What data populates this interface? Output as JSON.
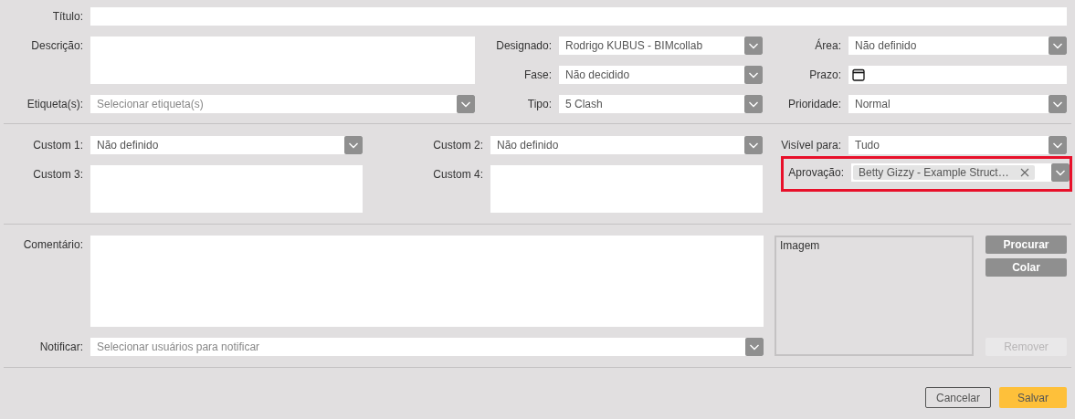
{
  "title": {
    "label": "Título:"
  },
  "description": {
    "label": "Descrição:"
  },
  "assigned": {
    "label": "Designado:",
    "value": "Rodrigo KUBUS - BIMcollab"
  },
  "area": {
    "label": "Área:",
    "value": "Não definido"
  },
  "phase": {
    "label": "Fase:",
    "value": "Não decidido"
  },
  "deadline": {
    "label": "Prazo:"
  },
  "tags": {
    "label": "Etiqueta(s):",
    "placeholder": "Selecionar etiqueta(s)"
  },
  "type": {
    "label": "Tipo:",
    "value": "5 Clash"
  },
  "priority": {
    "label": "Prioridade:",
    "value": "Normal"
  },
  "custom_1": {
    "label": "Custom 1:",
    "value": "Não definido"
  },
  "custom_2": {
    "label": "Custom 2:",
    "value": "Não definido"
  },
  "visible_to": {
    "label": "Visível para:",
    "value": "Tudo"
  },
  "custom_3": {
    "label": "Custom 3:"
  },
  "custom_4": {
    "label": "Custom 4:"
  },
  "approval": {
    "label": "Aprovação:",
    "highlighted": true,
    "chips": [
      {
        "text": "Betty Gizzy - Example Struct…"
      }
    ]
  },
  "comment": {
    "label": "Comentário:"
  },
  "notify": {
    "label": "Notificar:",
    "placeholder": "Selecionar usuários para notificar"
  },
  "image": {
    "label": "Imagem"
  },
  "image_buttons": [
    {
      "label": "Procurar",
      "disabled": false
    },
    {
      "label": "Colar",
      "disabled": false
    },
    {
      "label": "Remover",
      "disabled": true
    }
  ],
  "footer_buttons": [
    {
      "label": "Cancelar",
      "kind": "secondary"
    },
    {
      "label": "Salvar",
      "kind": "primary"
    }
  ]
}
